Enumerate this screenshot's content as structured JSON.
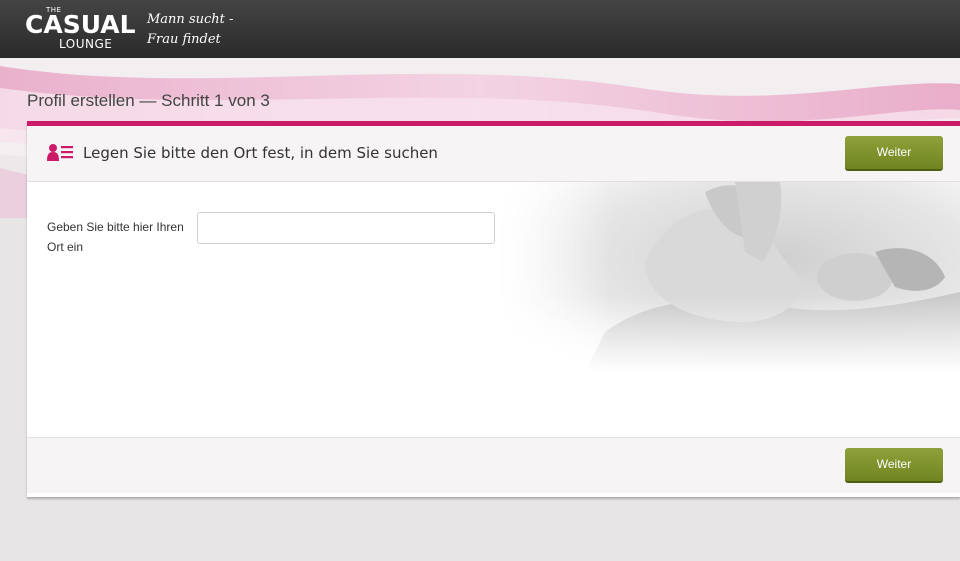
{
  "brand": {
    "logo_the": "THE",
    "logo_casual": "CASUAL",
    "logo_lounge": "LOUNGE",
    "tagline_line1": "Mann sucht -",
    "tagline_line2": "Frau findet"
  },
  "page": {
    "title": "Profil erstellen — Schritt 1 von 3"
  },
  "card": {
    "heading": "Legen Sie bitte den Ort fest, in dem Sie suchen",
    "heading_icon": "user-list-icon",
    "next_button_top": "Weiter",
    "next_button_bottom": "Weiter",
    "field_label": "Geben Sie bitte hier Ihren Ort ein",
    "field_value": "",
    "field_placeholder": ""
  },
  "colors": {
    "accent": "#cc1a6a",
    "button": "#7d9128",
    "header_bg": "#333333",
    "page_bg": "#e8e5e6"
  }
}
